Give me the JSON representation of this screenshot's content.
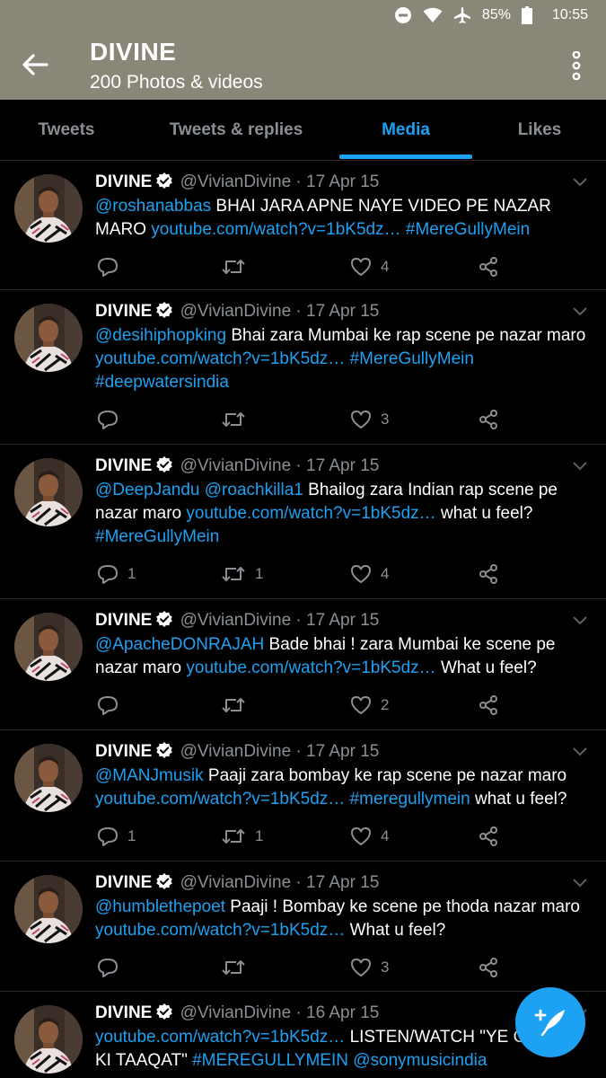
{
  "status_bar": {
    "battery": "85%",
    "time": "10:55"
  },
  "header": {
    "title": "DIVINE",
    "subtitle": "200 Photos & videos"
  },
  "tabs": [
    {
      "label": "Tweets",
      "active": false
    },
    {
      "label": "Tweets & replies",
      "active": false
    },
    {
      "label": "Media",
      "active": true
    },
    {
      "label": "Likes",
      "active": false
    }
  ],
  "colors": {
    "header_bg": "#8b8778",
    "accent": "#1da1f2",
    "background": "#000000",
    "muted": "#8a8f94"
  },
  "tweets": [
    {
      "name": "DIVINE",
      "meta": "@VivianDivine · 17 Apr 15",
      "parts": [
        {
          "t": "@roshanabbas",
          "link": true
        },
        {
          "t": " BHAI JARA APNE NAYE VIDEO PE NAZAR MARO ",
          "link": false
        },
        {
          "t": "youtube.com/watch?v=1bK5dz…",
          "link": true
        },
        {
          "t": " ",
          "link": false
        },
        {
          "t": "#MereGullyMein",
          "link": true
        }
      ],
      "replies": "",
      "retweets": "",
      "likes": "4"
    },
    {
      "name": "DIVINE",
      "meta": "@VivianDivine · 17 Apr 15",
      "parts": [
        {
          "t": "@desihiphopking",
          "link": true
        },
        {
          "t": " Bhai zara Mumbai ke rap scene pe nazar maro ",
          "link": false
        },
        {
          "t": "youtube.com/watch?v=1bK5dz…",
          "link": true
        },
        {
          "t": " ",
          "link": false
        },
        {
          "t": "#MereGullyMein",
          "link": true
        },
        {
          "t": " ",
          "link": false
        },
        {
          "t": "#deepwatersindia",
          "link": true
        }
      ],
      "replies": "",
      "retweets": "",
      "likes": "3"
    },
    {
      "name": "DIVINE",
      "meta": "@VivianDivine · 17 Apr 15",
      "parts": [
        {
          "t": "@DeepJandu",
          "link": true
        },
        {
          "t": " ",
          "link": false
        },
        {
          "t": "@roachkilla1",
          "link": true
        },
        {
          "t": " Bhailog zara Indian rap scene pe nazar maro ",
          "link": false
        },
        {
          "t": "youtube.com/watch?v=1bK5dz…",
          "link": true
        },
        {
          "t": " what u feel? ",
          "link": false
        },
        {
          "t": "#MereGullyMein",
          "link": true
        }
      ],
      "replies": "1",
      "retweets": "1",
      "likes": "4"
    },
    {
      "name": "DIVINE",
      "meta": "@VivianDivine · 17 Apr 15",
      "parts": [
        {
          "t": "@ApacheDONRAJAH",
          "link": true
        },
        {
          "t": " Bade bhai ! zara Mumbai ke scene pe nazar maro ",
          "link": false
        },
        {
          "t": "youtube.com/watch?v=1bK5dz…",
          "link": true
        },
        {
          "t": " What u feel?",
          "link": false
        }
      ],
      "replies": "",
      "retweets": "",
      "likes": "2"
    },
    {
      "name": "DIVINE",
      "meta": "@VivianDivine · 17 Apr 15",
      "parts": [
        {
          "t": "@MANJmusik",
          "link": true
        },
        {
          "t": " Paaji zara bombay ke rap scene pe nazar maro ",
          "link": false
        },
        {
          "t": "youtube.com/watch?v=1bK5dz…",
          "link": true
        },
        {
          "t": " ",
          "link": false
        },
        {
          "t": "#meregullymein",
          "link": true
        },
        {
          "t": " what u feel?",
          "link": false
        }
      ],
      "replies": "1",
      "retweets": "1",
      "likes": "4"
    },
    {
      "name": "DIVINE",
      "meta": "@VivianDivine · 17 Apr 15",
      "parts": [
        {
          "t": "@humblethepoet",
          "link": true
        },
        {
          "t": " Paaji ! Bombay ke scene pe thoda nazar maro ",
          "link": false
        },
        {
          "t": "youtube.com/watch?v=1bK5dz…",
          "link": true
        },
        {
          "t": " What u feel?",
          "link": false
        }
      ],
      "replies": "",
      "retweets": "",
      "likes": "3"
    },
    {
      "name": "DIVINE",
      "meta": "@VivianDivine · 16 Apr 15",
      "parts": [
        {
          "t": "youtube.com/watch?v=1bK5dz…",
          "link": true
        },
        {
          "t": " LISTEN/WATCH \"YE GULLLY KI TAAQAT\"  ",
          "link": false
        },
        {
          "t": "#MEREGULLYMEIN",
          "link": true
        },
        {
          "t": " ",
          "link": false
        },
        {
          "t": "@sonymusicindia",
          "link": true
        }
      ],
      "replies": "",
      "retweets": "",
      "likes": ""
    }
  ]
}
